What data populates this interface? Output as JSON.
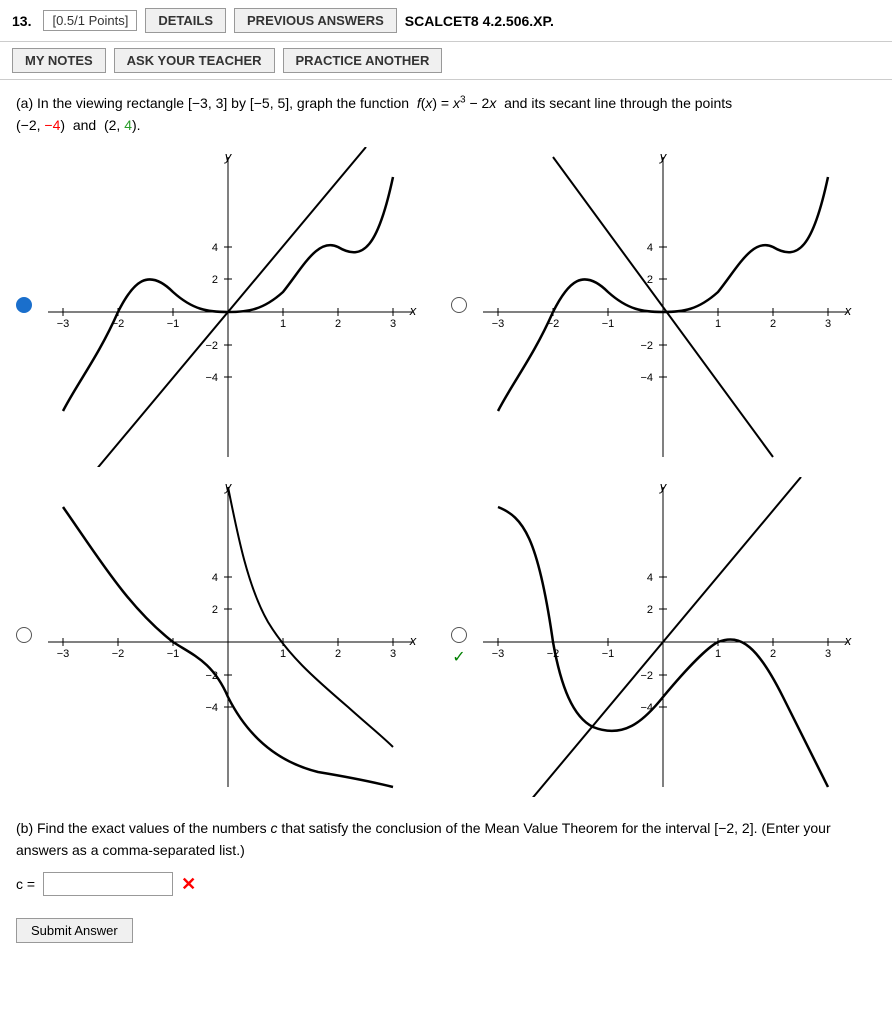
{
  "header": {
    "question_number": "13.",
    "points": "[0.5/1 Points]",
    "details_label": "DETAILS",
    "previous_answers_label": "PREVIOUS ANSWERS",
    "source": "SCALCET8 4.2.506.XP.",
    "my_notes_label": "MY NOTES",
    "ask_teacher_label": "ASK YOUR TEACHER",
    "practice_another_label": "PRACTICE ANOTHER"
  },
  "problem": {
    "part_a_text": "(a) In the viewing rectangle [−3, 3] by [−5, 5], graph the function  f(x) = x³ − 2x  and its secant line through the points (−2, −4)  and  (2, 4).",
    "part_b_text": "(b) Find the exact values of the numbers c that satisfy the conclusion of the Mean Value Theorem for the interval [−2, 2]. (Enter your answers as a comma-separated list.)",
    "c_label": "c =",
    "c_value": "",
    "c_placeholder": "",
    "submit_label": "Submit Answer"
  },
  "graphs": [
    {
      "id": 1,
      "selected": true,
      "selected_type": "blue"
    },
    {
      "id": 2,
      "selected": false
    },
    {
      "id": 3,
      "selected": false
    },
    {
      "id": 4,
      "selected": true,
      "selected_type": "green"
    }
  ]
}
